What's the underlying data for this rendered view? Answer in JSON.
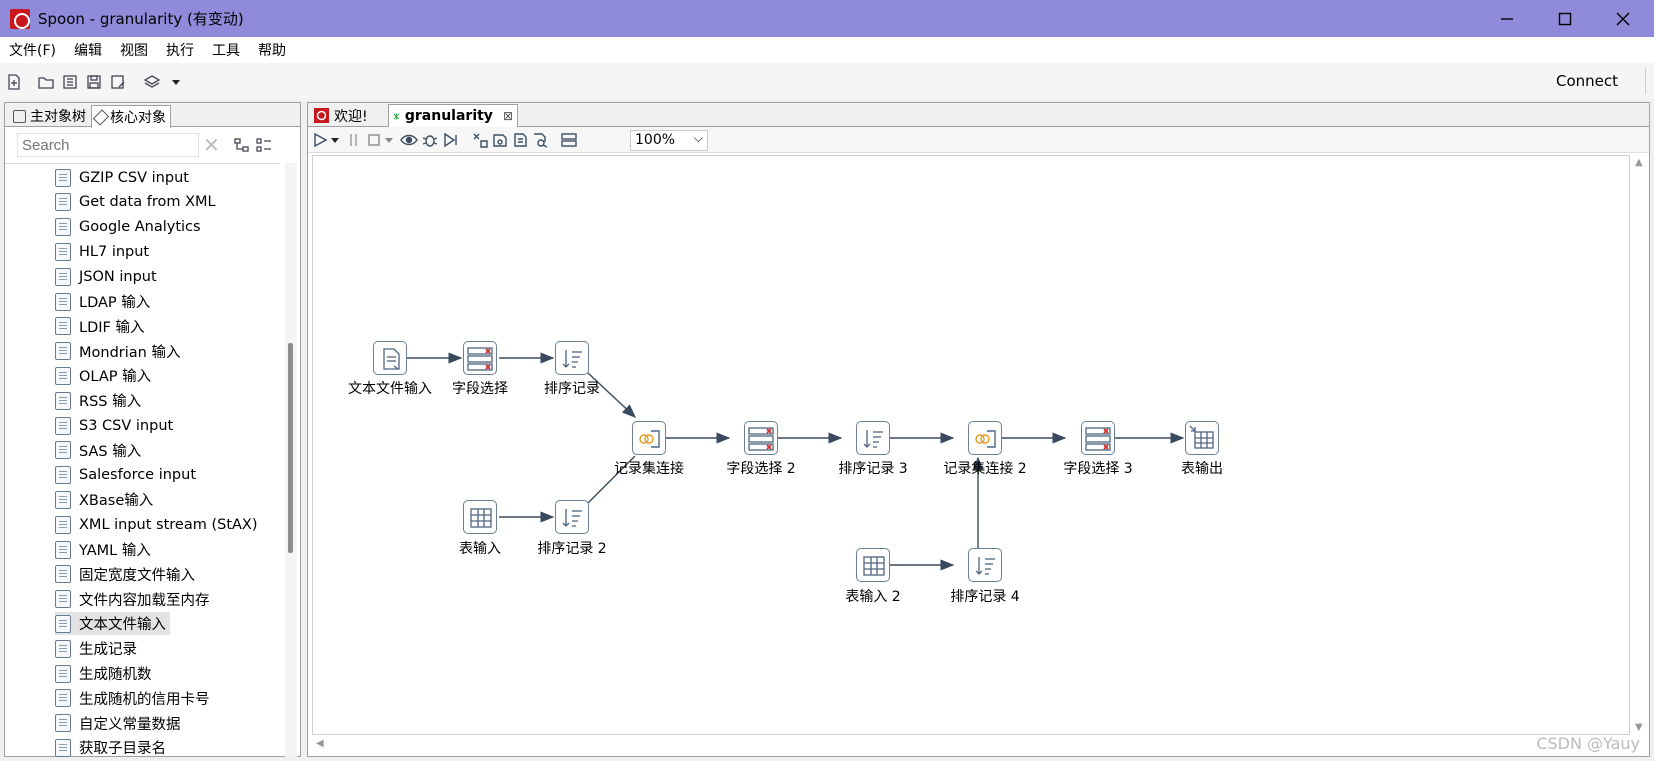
{
  "window": {
    "title": "Spoon - granularity (有变动)"
  },
  "menu": [
    "文件(F)",
    "编辑",
    "视图",
    "执行",
    "工具",
    "帮助"
  ],
  "toolbar": {
    "connect_label": "Connect"
  },
  "left_panel": {
    "tabs": [
      "主对象树",
      "核心对象"
    ],
    "search_placeholder": "Search",
    "items": [
      "GZIP CSV input",
      "Get data from XML",
      "Google Analytics",
      "HL7 input",
      "JSON input",
      "LDAP 输入",
      "LDIF 输入",
      "Mondrian 输入",
      "OLAP 输入",
      "RSS 输入",
      "S3 CSV input",
      "SAS 输入",
      "Salesforce input",
      "XBase输入",
      "XML input stream (StAX)",
      "YAML 输入",
      "固定宽度文件输入",
      "文件内容加载至内存",
      "文本文件输入",
      "生成记录",
      "生成随机数",
      "生成随机的信用卡号",
      "自定义常量数据",
      "获取子目录名"
    ],
    "selected_item": "文本文件输入"
  },
  "editor": {
    "tabs": [
      "欢迎!",
      "granularity"
    ],
    "zoom": "100%"
  },
  "steps": {
    "s1": "文本文件输入",
    "s2": "字段选择",
    "s3": "排序记录",
    "s4": "表输入",
    "s5": "排序记录 2",
    "s6": "记录集连接",
    "s7": "字段选择 2",
    "s8": "排序记录 3",
    "s9": "记录集连接 2",
    "s10": "字段选择 3",
    "s11": "表输出",
    "s12": "表输入 2",
    "s13": "排序记录 4"
  },
  "watermark": "CSDN @Yauy"
}
